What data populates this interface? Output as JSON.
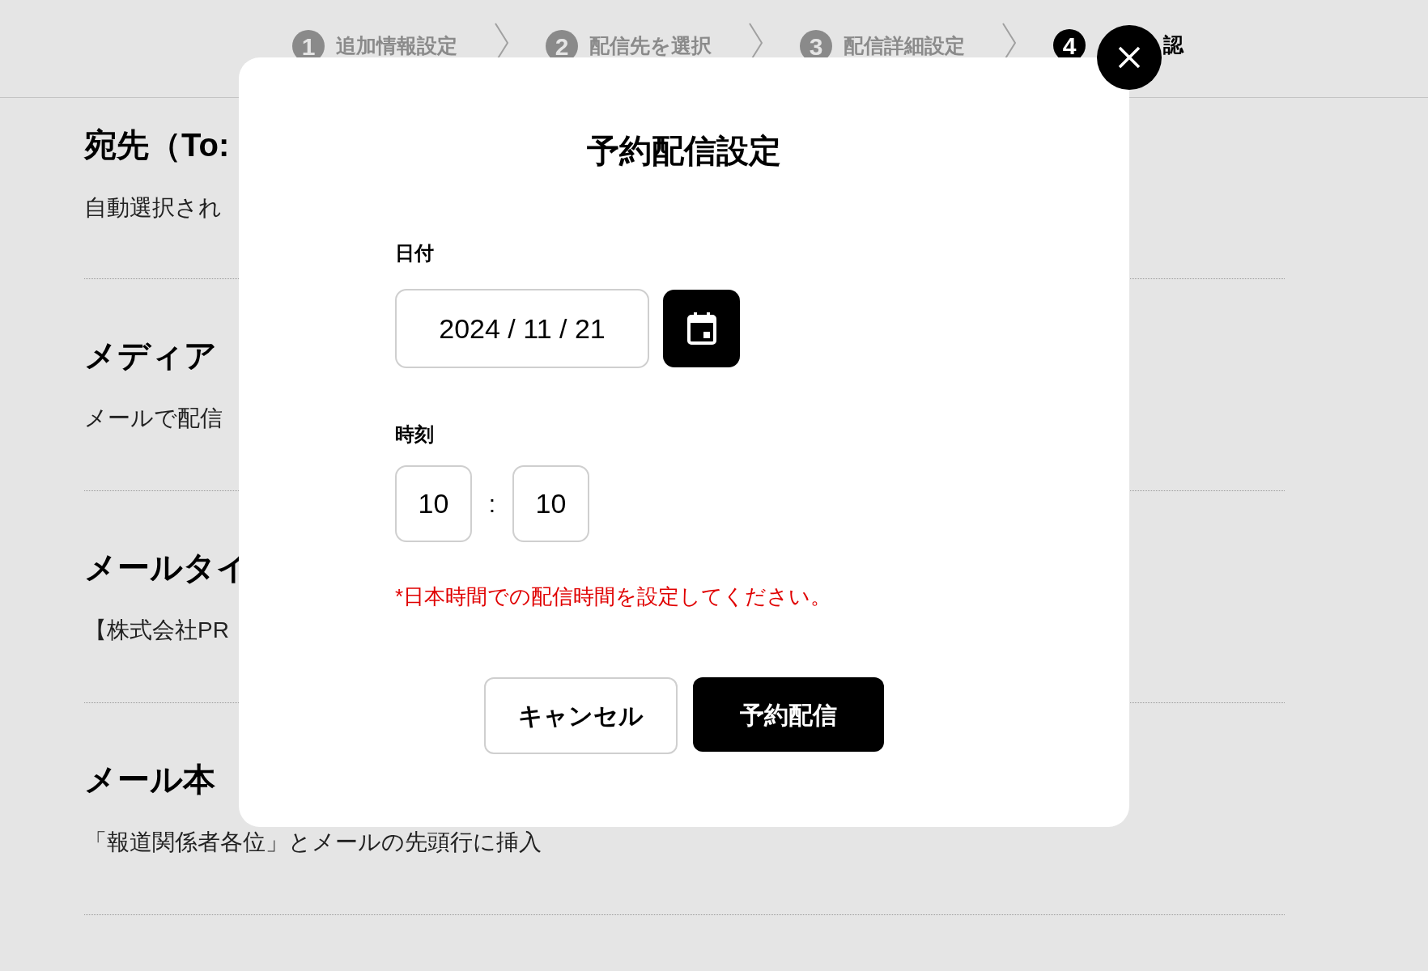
{
  "steps": [
    {
      "number": "1",
      "label": "追加情報設定",
      "selected": false
    },
    {
      "number": "2",
      "label": "配信先を選択",
      "selected": false
    },
    {
      "number": "3",
      "label": "配信詳細設定",
      "selected": false
    },
    {
      "number": "4",
      "label": "認",
      "selected": true
    }
  ],
  "sections": [
    {
      "heading": "宛先（To:",
      "text": "自動選択され"
    },
    {
      "heading": "メディア",
      "text": "メールで配信"
    },
    {
      "heading": "メールタイ",
      "text": "【株式会社PR"
    },
    {
      "heading": "メール本",
      "text": "「報道関係者各位」とメールの先頭行に挿入"
    }
  ],
  "modal": {
    "title": "予約配信設定",
    "date_label": "日付",
    "date_value": "2024 / 11 / 21",
    "time_label": "時刻",
    "hour": "10",
    "separator": ":",
    "minute": "10",
    "note": "*日本時間での配信時間を設定してください。",
    "cancel": "キャンセル",
    "submit": "予約配信"
  }
}
